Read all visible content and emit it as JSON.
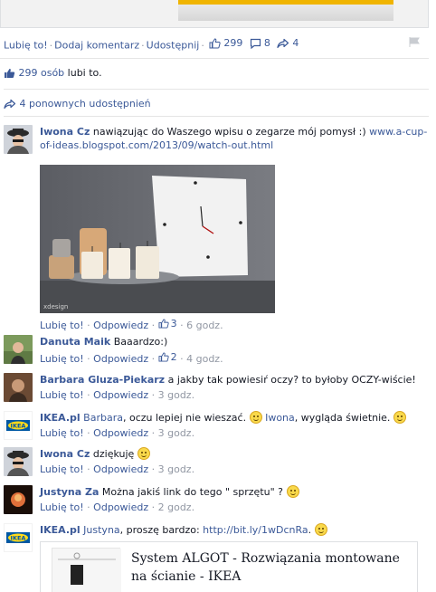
{
  "post_actions": {
    "like": "Lubię to!",
    "comment": "Dodaj komentarz",
    "share": "Udostępnij",
    "like_count": "299",
    "comment_count": "8",
    "share_count": "4"
  },
  "likes_summary": {
    "count_text": "299 osób",
    "suffix": "lubi to."
  },
  "shares_summary": {
    "text": "4 ponownych udostępnień"
  },
  "comments": [
    {
      "author": "Iwona Cz",
      "text": "nawiązując do Waszego wpisu o zegarze mój pomysł :)",
      "link": "www.a-cup-of-ideas.blogspot.com/2013/09/watch-out.html",
      "photo_watermark": "xdesign",
      "like": "Lubię to!",
      "reply": "Odpowiedz",
      "likes": "3",
      "time": "6 godz."
    },
    {
      "author": "Danuta Maik",
      "text": "Baaardzo:)",
      "like": "Lubię to!",
      "reply": "Odpowiedz",
      "likes": "2",
      "time": "4 godz."
    },
    {
      "author": "Barbara Gluza-Piekarz",
      "text": "a jakby tak powiesiŕ oczy? to byłoby OCZY-wiście!",
      "like": "Lubię to!",
      "reply": "Odpowiedz",
      "time": "3 godz."
    },
    {
      "author": "IKEA.pl",
      "mention1": "Barbara",
      "text1": ", oczu lepiej nie wieszać.",
      "mention2": "Iwona",
      "text2": ", wygląda świetnie.",
      "like": "Lubię to!",
      "reply": "Odpowiedz",
      "time": "3 godz."
    },
    {
      "author": "Iwona Cz",
      "text": "dziękuję",
      "like": "Lubię to!",
      "reply": "Odpowiedz",
      "time": "3 godz."
    },
    {
      "author": "Justyna Za",
      "text": "Można jakiś link do tego \" sprzętu\" ?",
      "like": "Lubię to!",
      "reply": "Odpowiedz",
      "time": "2 godz."
    },
    {
      "author": "IKEA.pl",
      "mention1": "Justyna",
      "text1": ", proszę bardzo:",
      "link": "http://bit.ly/1wDcnRa",
      "text2": ".",
      "preview_title": "System ALGOT - Rozwiązania montowane na ścianie - IKEA"
    }
  ],
  "colors": {
    "link": "#3b5998",
    "meta": "#9197a3",
    "text": "#141823"
  },
  "logo_text": "IKEA"
}
